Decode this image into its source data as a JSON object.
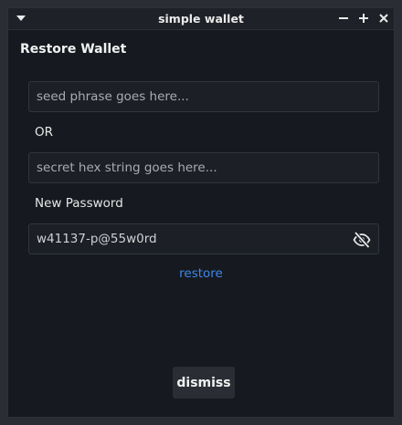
{
  "window": {
    "title": "simple wallet"
  },
  "titlebar": {
    "menu_icon": "menu-triangle-icon",
    "minimize_icon": "minimize-icon",
    "maximize_icon": "maximize-icon",
    "close_icon": "close-icon"
  },
  "restore": {
    "heading": "Restore Wallet",
    "seed_placeholder": "seed phrase goes here...",
    "seed_value": "",
    "or_label": "OR",
    "hex_placeholder": "secret hex string goes here...",
    "hex_value": "",
    "password_label": "New Password",
    "password_value": "w41137-p@55w0rd",
    "visibility_icon": "eye-off-icon",
    "restore_label": "restore",
    "dismiss_label": "dismiss"
  },
  "colors": {
    "background": "#161a20",
    "titlebar": "#1e2127",
    "accent_link": "#3f87e8",
    "field_bg": "#1c1f25",
    "button_bg": "#2a2e34"
  }
}
